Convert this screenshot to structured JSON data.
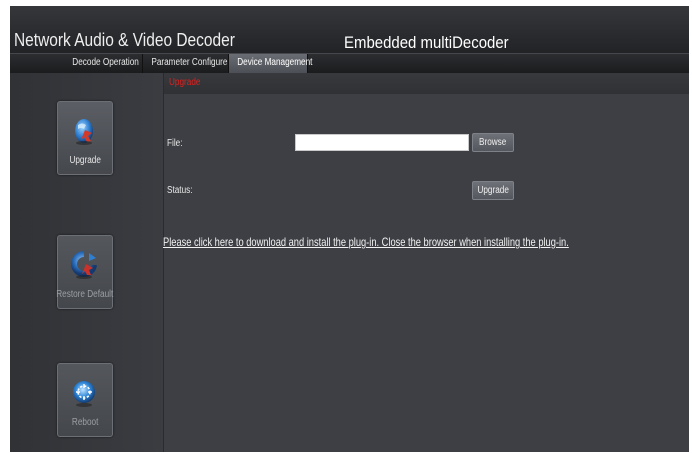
{
  "header": {
    "title": "Network Audio & Video Decoder",
    "subtitle": "Embedded multiDecoder"
  },
  "tabs": [
    {
      "label": "Decode Operation",
      "active": false
    },
    {
      "label": "Parameter Configure",
      "active": false
    },
    {
      "label": "Device Management",
      "active": true
    }
  ],
  "sidebar": {
    "items": [
      {
        "label": "Upgrade",
        "icon": "upgrade-icon",
        "active": true
      },
      {
        "label": "Restore Default",
        "icon": "restore-default-icon",
        "active": false
      },
      {
        "label": "Reboot",
        "icon": "reboot-icon",
        "active": false
      }
    ]
  },
  "content": {
    "section_title": "Upgrade",
    "file_label": "File:",
    "file_value": "",
    "browse_label": "Browse",
    "status_label": "Status:",
    "upgrade_label": "Upgrade",
    "plugin_link": "Please click here to download and install the plug-in. Close the browser when installing the plug-in."
  },
  "colors": {
    "background": "#3d3f44",
    "section_title": "#e0201e",
    "active_tab": "#5b5e64"
  }
}
